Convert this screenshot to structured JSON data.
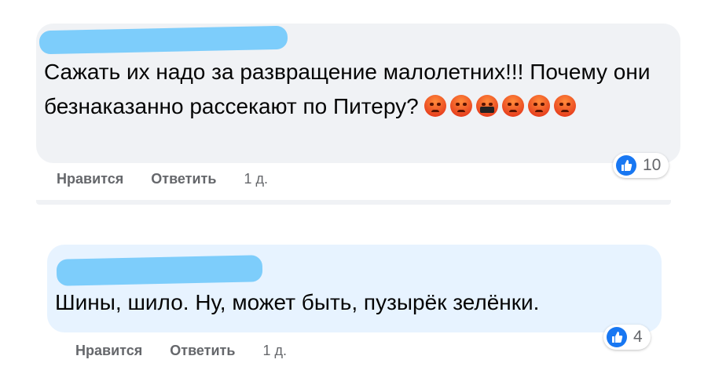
{
  "comments": [
    {
      "text": "Сажать их надо за развращение малолетних!!! Почему они безнаказанно рассекают по Питеру?",
      "emojis": [
        "angry-face-icon",
        "angry-face-icon",
        "face-with-symbols-on-mouth-icon",
        "angry-face-icon",
        "angry-face-icon",
        "angry-face-icon"
      ],
      "actions": {
        "like": "Нравится",
        "reply": "Ответить",
        "time": "1 д."
      },
      "reaction_count": "10"
    },
    {
      "text": "Шины, шило. Ну, может быть, пузырёк зелёнки.",
      "actions": {
        "like": "Нравится",
        "reply": "Ответить",
        "time": "1 д."
      },
      "reaction_count": "4"
    }
  ],
  "colors": {
    "bubble_gray": "#f0f2f5",
    "bubble_blue": "#e7f3ff",
    "redaction": "#7dcdfb",
    "like_blue": "#1877f2",
    "meta_text": "#65676b"
  }
}
